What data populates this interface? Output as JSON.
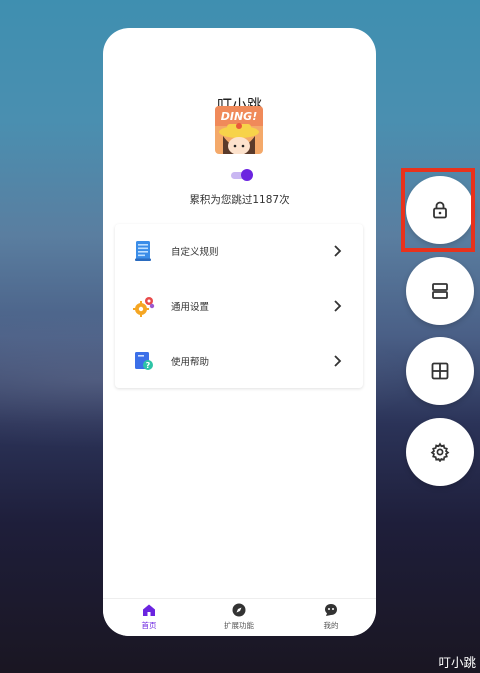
{
  "app": {
    "title": "叮小跳",
    "avatar_text": "DING!",
    "count_text": "累积为您跳过1187次",
    "toggle_on": true
  },
  "menu": {
    "items": [
      {
        "label": "自定义规则",
        "icon": "document-blue-icon"
      },
      {
        "label": "通用设置",
        "icon": "gears-icon"
      },
      {
        "label": "使用帮助",
        "icon": "help-book-icon"
      }
    ]
  },
  "tabbar": {
    "tabs": [
      {
        "label": "首页",
        "icon": "home-icon",
        "active": true
      },
      {
        "label": "扩展功能",
        "icon": "compass-icon",
        "active": false
      },
      {
        "label": "我的",
        "icon": "chat-face-icon",
        "active": false
      }
    ]
  },
  "floating_buttons": [
    {
      "icon": "lock-icon",
      "highlighted": true
    },
    {
      "icon": "split-view-icon",
      "highlighted": false
    },
    {
      "icon": "grid-icon",
      "highlighted": false
    },
    {
      "icon": "settings-gear-icon",
      "highlighted": false
    }
  ],
  "watermark": "叮小跳",
  "colors": {
    "accent": "#6b24e0",
    "highlight": "#e8321c"
  }
}
